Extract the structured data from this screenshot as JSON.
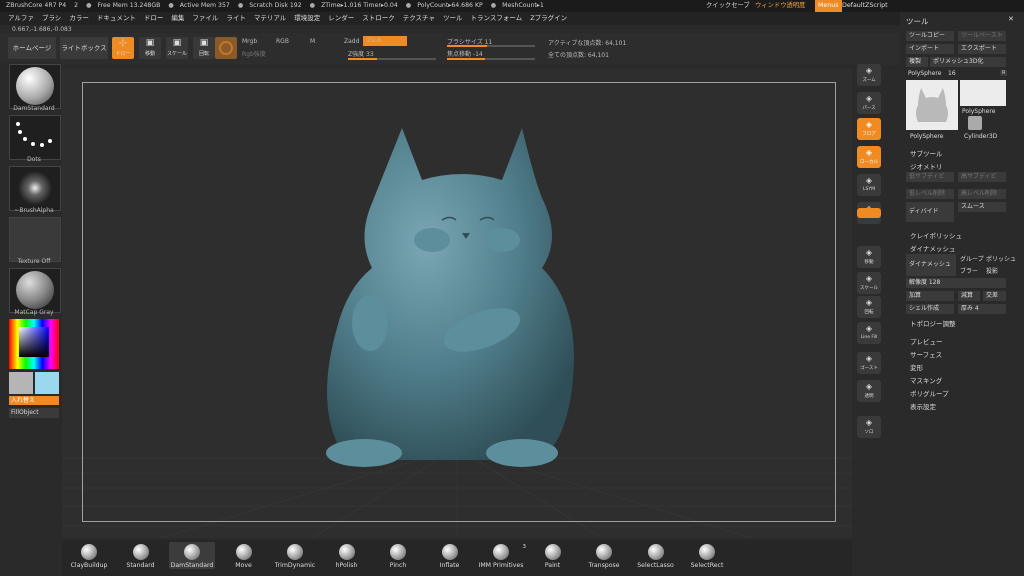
{
  "statusbar": {
    "app": "ZBrushCore 4R7 P4",
    "num": "2",
    "free_mem": "Free Mem 13.248GB",
    "active_mem": "Active Mem 357",
    "scratch": "Scratch Disk 192",
    "ztime": "ZTime▸1.016 Timer▸0.04",
    "polycount": "PolyCount▸64.686 KP",
    "meshcount": "MeshCount▸1",
    "quicksave": "クイックセーブ",
    "window_transparency": "ウィンドウ透明度",
    "menus": "Menus",
    "script": "DefaultZScript"
  },
  "menubar": [
    "アルファ",
    "ブラシ",
    "カラー",
    "ドキュメント",
    "ドロー",
    "編集",
    "ファイル",
    "ライト",
    "マテリアル",
    "環境設定",
    "レンダー",
    "ストローク",
    "テクスチャ",
    "ツール",
    "トランスフォーム",
    "Zプラグイン"
  ],
  "coords": "0.667,-1.686,-0.083",
  "toolbar": {
    "home": "ホームページ",
    "lightbox": "ライトボックス",
    "draw": "ドロー",
    "move": "移動",
    "scale": "スケール",
    "rotate": "回転",
    "mrgb": "Mrgb",
    "rgb": "RGB",
    "m": "M",
    "rgb_intensity": "Rgb強度",
    "zadd": "Zadd",
    "zsub": "Zsub",
    "z_intensity": "Z強度 33",
    "brush_size": "ブラシサイズ 11",
    "focal_shift": "焦点移動 -14",
    "active_points": "アクティブな頂点数: 64,101",
    "total_points": "全ての頂点数: 64,101"
  },
  "leftpanel": {
    "brush": "DamStandard",
    "stroke": "Dots",
    "alpha": "~BrushAlpha",
    "texture": "Texture Off",
    "material": "MatCap Gray",
    "swap": "入れ替え",
    "fill": "FillObject"
  },
  "righticons": [
    "ズーム",
    "パース",
    "フロア",
    "ローカル",
    "LSYM",
    "XYZ",
    "",
    "",
    "移動",
    "スケール",
    "回転",
    "Line Fill",
    "ゴースト",
    "透明",
    "",
    "ソロ"
  ],
  "rightpanel": {
    "title": "ツール",
    "copy": "ツールコピー",
    "paste": "ツールペースト",
    "import": "インポート",
    "export": "エクスポート",
    "clone": "複製",
    "polymesh3d": "ポリメッシュ3D化",
    "polysphere_label": "PolySphere",
    "polysphere_value": "16",
    "thumb1": "PolySphere",
    "thumb2": "PolySphere",
    "thumb3": "Cylinder3D",
    "subtool": "サブツール",
    "geometry": "ジオメトリ",
    "lower_sub": "低サブディビ",
    "higher_sub": "高サブディビ",
    "del_lower": "低レベル削除",
    "del_higher": "高レベル削除",
    "divide": "ディバイド",
    "smooth": "スムース",
    "claypolish": "クレイポリッシュ",
    "dynamesh": "ダイナメッシュ",
    "dynamesh_btn": "ダイナメッシュ",
    "group": "グループ",
    "polish": "ポリッシュ",
    "blur": "ブラー",
    "project": "投影",
    "resolution": "解像度 128",
    "add": "加算",
    "sub": "減算",
    "intersect": "交差",
    "shell": "シェル作成",
    "thickness": "厚み 4",
    "topology": "トポロジー調整",
    "preview": "プレビュー",
    "surface": "サーフェス",
    "deform": "変形",
    "masking": "マスキング",
    "polygroups": "ポリグループ",
    "display": "表示設定"
  },
  "bottombar": [
    "ClayBuildup",
    "Standard",
    "DamStandard",
    "Move",
    "TrimDynamic",
    "hPolish",
    "Pinch",
    "Inflate",
    "IMM Primitives",
    "Paint",
    "Transpose",
    "SelectLasso",
    "SelectRect"
  ],
  "imm_count": "3",
  "colors": {
    "accent": "#f08a22",
    "model": "#4f7d8a",
    "swatch_a": "#b5b5b5",
    "swatch_b": "#9ad8f0"
  }
}
